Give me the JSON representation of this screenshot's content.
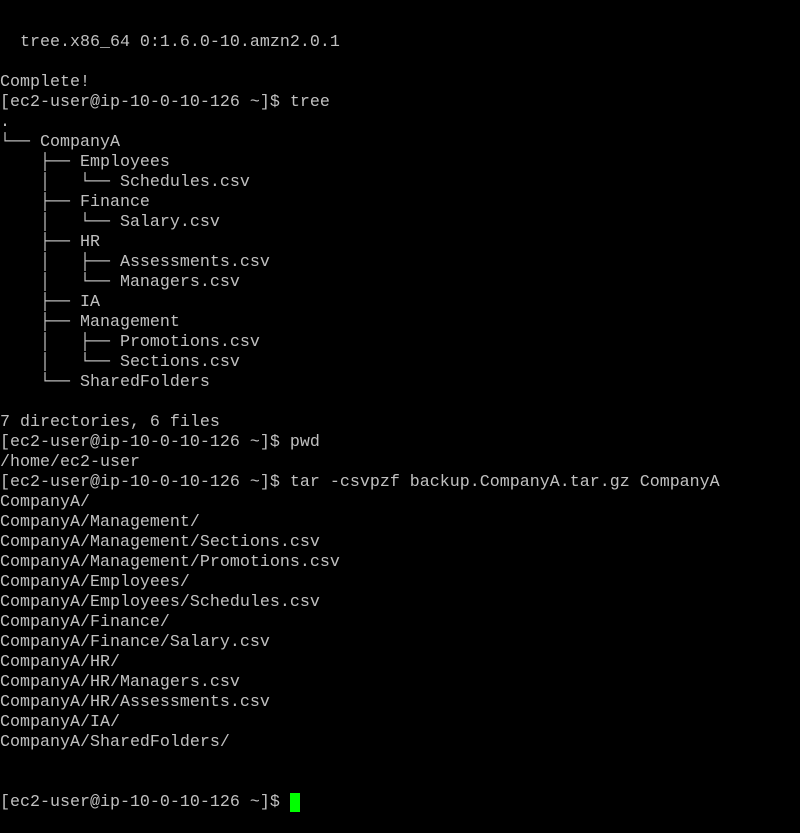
{
  "terminal": {
    "lines": [
      "  tree.x86_64 0:1.6.0-10.amzn2.0.1",
      "",
      "Complete!",
      "[ec2-user@ip-10-0-10-126 ~]$ tree",
      ".",
      "└── CompanyA",
      "    ├── Employees",
      "    │   └── Schedules.csv",
      "    ├── Finance",
      "    │   └── Salary.csv",
      "    ├── HR",
      "    │   ├── Assessments.csv",
      "    │   └── Managers.csv",
      "    ├── IA",
      "    ├── Management",
      "    │   ├── Promotions.csv",
      "    │   └── Sections.csv",
      "    └── SharedFolders",
      "",
      "7 directories, 6 files",
      "[ec2-user@ip-10-0-10-126 ~]$ pwd",
      "/home/ec2-user",
      "[ec2-user@ip-10-0-10-126 ~]$ tar -csvpzf backup.CompanyA.tar.gz CompanyA",
      "CompanyA/",
      "CompanyA/Management/",
      "CompanyA/Management/Sections.csv",
      "CompanyA/Management/Promotions.csv",
      "CompanyA/Employees/",
      "CompanyA/Employees/Schedules.csv",
      "CompanyA/Finance/",
      "CompanyA/Finance/Salary.csv",
      "CompanyA/HR/",
      "CompanyA/HR/Managers.csv",
      "CompanyA/HR/Assessments.csv",
      "CompanyA/IA/",
      "CompanyA/SharedFolders/"
    ],
    "prompt": "[ec2-user@ip-10-0-10-126 ~]$ ",
    "colors": {
      "background": "#000000",
      "text": "#c0c0c0",
      "cursor": "#00ff00"
    }
  }
}
